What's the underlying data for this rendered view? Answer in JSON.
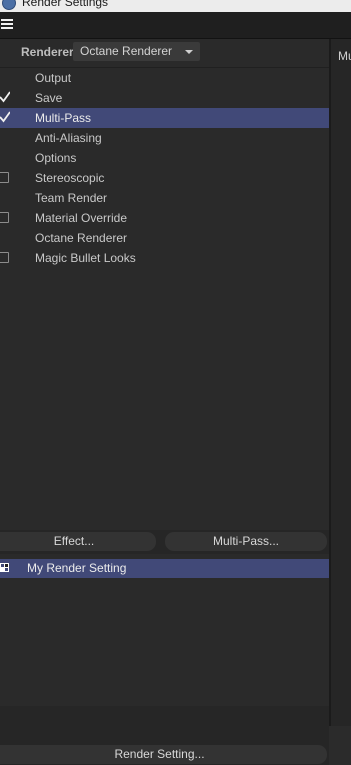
{
  "window": {
    "title": "Render Settings"
  },
  "renderer": {
    "label": "Renderer",
    "selected": "Octane Renderer"
  },
  "settings": [
    {
      "label": "Output",
      "checkbox": "none"
    },
    {
      "label": "Save",
      "checkbox": "checked"
    },
    {
      "label": "Multi-Pass",
      "checkbox": "checked",
      "selected": true
    },
    {
      "label": "Anti-Aliasing",
      "checkbox": "none"
    },
    {
      "label": "Options",
      "checkbox": "none"
    },
    {
      "label": "Stereoscopic",
      "checkbox": "unchecked"
    },
    {
      "label": "Team Render",
      "checkbox": "none"
    },
    {
      "label": "Material Override",
      "checkbox": "unchecked"
    },
    {
      "label": "Octane Renderer",
      "checkbox": "none"
    },
    {
      "label": "Magic Bullet Looks",
      "checkbox": "unchecked"
    }
  ],
  "buttons": {
    "effect": "Effect...",
    "multipass": "Multi-Pass...",
    "render_setting": "Render Setting..."
  },
  "render_settings": [
    {
      "label": "My Render Setting",
      "selected": true
    }
  ],
  "right_panel": {
    "tab_peek": "Mu"
  },
  "colors": {
    "selection": "#414978",
    "panel": "#2a2a2a",
    "menubar": "#1f1f1f"
  }
}
